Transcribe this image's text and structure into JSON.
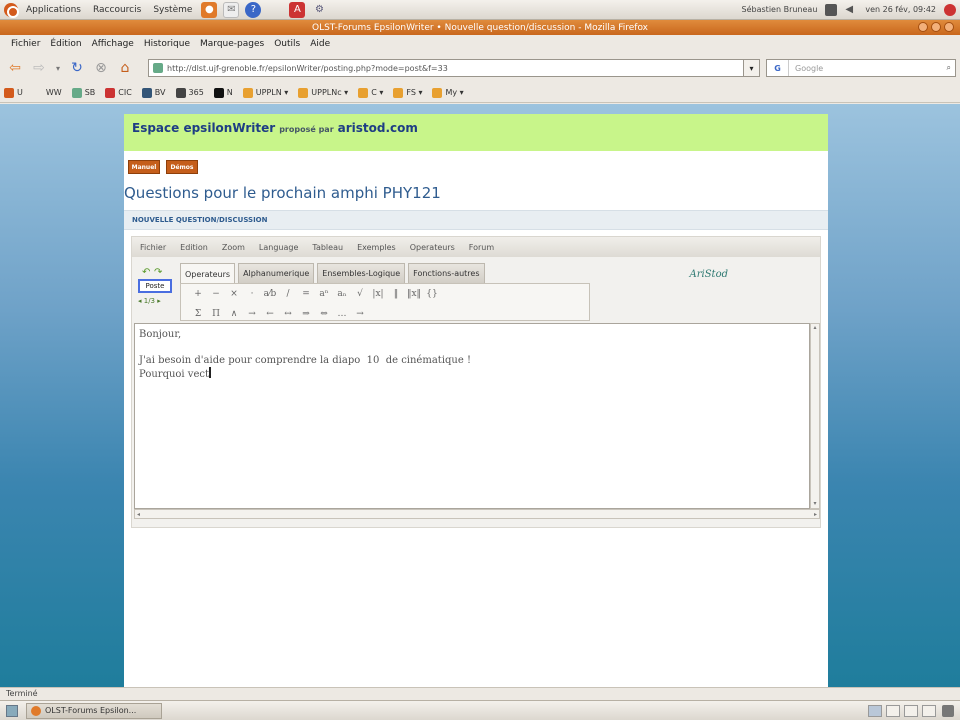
{
  "top_panel": {
    "menus": [
      "Applications",
      "Raccourcis",
      "Système"
    ],
    "user": "Sébastien Bruneau",
    "clock": "ven 26 fév, 09:42"
  },
  "window": {
    "title": "OLST-Forums EpsilonWriter • Nouvelle question/discussion - Mozilla Firefox"
  },
  "menubar": [
    "Fichier",
    "Édition",
    "Affichage",
    "Historique",
    "Marque-pages",
    "Outils",
    "Aide"
  ],
  "navbar": {
    "url": "http://dlst.ujf-grenoble.fr/epsilonWriter/posting.php?mode=post&f=33",
    "search_placeholder": "Google",
    "search_engine": "G"
  },
  "bookmarks": [
    {
      "label": "U",
      "color": "#d35a1c"
    },
    {
      "label": "WW",
      "color": "#ede9e3"
    },
    {
      "label": "SB",
      "color": "#6a8"
    },
    {
      "label": "CIC",
      "color": "#c33"
    },
    {
      "label": "BV",
      "color": "#357"
    },
    {
      "label": "365",
      "color": "#444"
    },
    {
      "label": "N",
      "color": "#111"
    },
    {
      "label": "UPPLN ▾",
      "color": "#e8a030"
    },
    {
      "label": "UPPLNc ▾",
      "color": "#e8a030"
    },
    {
      "label": "C ▾",
      "color": "#e8a030"
    },
    {
      "label": "FS ▾",
      "color": "#e8a030"
    },
    {
      "label": "My ▾",
      "color": "#e8a030"
    }
  ],
  "page": {
    "banner_title": "Espace epsilonWriter",
    "banner_propose": "proposé par",
    "banner_site": "aristod.com",
    "btn_manuel": "Manuel",
    "btn_demos": "Démos",
    "title": "Questions pour le prochain amphi PHY121",
    "section": "NOUVELLE QUESTION/DISCUSSION"
  },
  "editor": {
    "menu": [
      "Fichier",
      "Edition",
      "Zoom",
      "Language",
      "Tableau",
      "Exemples",
      "Operateurs",
      "Forum"
    ],
    "poste_label": "Poste",
    "pager": "◂ 1/3 ▸",
    "tabs": [
      "Operateurs",
      "Alphanumerique",
      "Ensembles-Logique",
      "Fonctions-autres"
    ],
    "logo": "AriStod",
    "symbols_row1": [
      "+",
      "−",
      "×",
      "·",
      "a⁄b",
      "/",
      "=",
      "aⁿ",
      "aₙ",
      "√",
      "|x|",
      "‖",
      "‖x‖",
      "{}"
    ],
    "symbols_row2": [
      "Σ",
      "Π",
      "∧",
      "→",
      "←",
      "↔",
      "⇒",
      "⇔",
      "…",
      "→"
    ],
    "lines": [
      "Bonjour,",
      "",
      "J'ai besoin d'aide pour comprendre la diapo  10  de cinématique !",
      "Pourquoi vect"
    ]
  },
  "status": "Terminé",
  "taskbar": {
    "task": "OLST-Forums Epsilon..."
  }
}
